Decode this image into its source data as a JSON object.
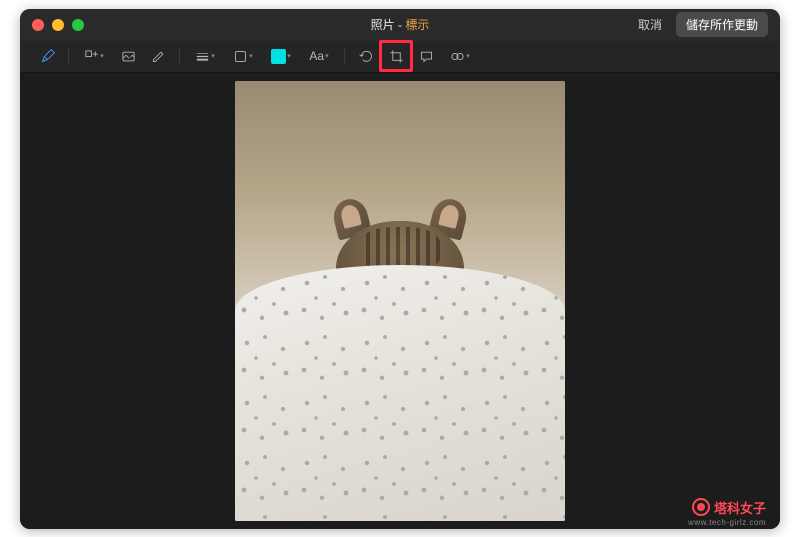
{
  "titlebar": {
    "app_name": "照片",
    "separator": " - ",
    "mode": "標示",
    "cancel_label": "取消",
    "save_label": "儲存所作更動"
  },
  "toolbar": {
    "marker_icon": "marker",
    "shapes_icon": "shapes",
    "insert_icon": "insert-shape",
    "draw_icon": "pencil",
    "line_icon": "line-style",
    "border_icon": "border-style",
    "color_icon": "fill-color",
    "text_label": "Aa",
    "rotate_icon": "rotate",
    "crop_icon": "crop",
    "annotate_icon": "speech-bubble",
    "adjust_icon": "adjust-levels"
  },
  "colors": {
    "swatch": "#00e0e0",
    "highlight_border": "#ff2d3f"
  },
  "watermark": {
    "text": "塔科女子",
    "url": "www.tech-girlz.com"
  }
}
